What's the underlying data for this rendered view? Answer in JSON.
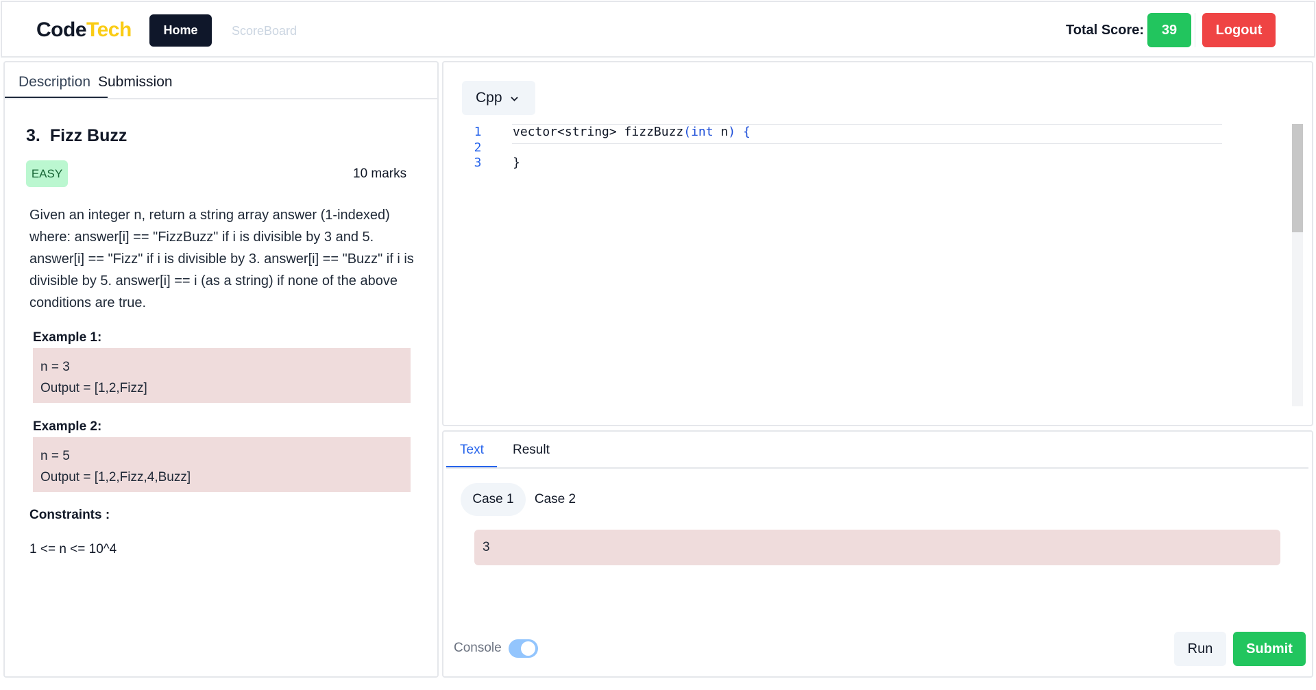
{
  "nav": {
    "logo_part1": "Code",
    "logo_part2": "Tech",
    "home_label": "Home",
    "scoreboard_label": "ScoreBoard",
    "total_score_label": "Total Score:",
    "total_score_value": "39",
    "logout_label": "Logout"
  },
  "problem_panel": {
    "tabs": [
      "Description",
      "Submission"
    ],
    "active_tab": "Description",
    "number": "3.",
    "title": "Fizz Buzz",
    "difficulty": "EASY",
    "marks": "10 marks",
    "description": "Given an integer n, return a string array answer (1-indexed) where: answer[i] == \"FizzBuzz\" if i is divisible by 3 and 5. answer[i] == \"Fizz\" if i is divisible by 3. answer[i] == \"Buzz\" if i is divisible by 5. answer[i] == i (as a string) if none of the above conditions are true.",
    "examples": [
      {
        "title": "Example 1:",
        "input": "n = 3",
        "output": "Output = [1,2,Fizz]"
      },
      {
        "title": "Example 2:",
        "input": "n = 5",
        "output": "Output = [1,2,Fizz,4,Buzz]"
      }
    ],
    "constraints_title": "Constraints :",
    "constraints": "1 <= n <= 10^4"
  },
  "editor": {
    "language": "Cpp",
    "lines": [
      {
        "num": "1",
        "prefix": "vector<string> fizzBuzz",
        "paren_open": "(",
        "kw": "int",
        "arg": " n",
        "paren_close": ")",
        "brace": " {"
      },
      {
        "num": "2"
      },
      {
        "num": "3",
        "brace": "}"
      }
    ]
  },
  "testcases": {
    "tabs": [
      "Text",
      "Result"
    ],
    "active_tab": "Text",
    "cases": [
      "Case 1",
      "Case 2"
    ],
    "active_case": "Case 1",
    "input_value": "3",
    "console_label": "Console",
    "console_enabled": true,
    "run_label": "Run",
    "submit_label": "Submit"
  },
  "colors": {
    "accent_green": "#22c55e",
    "logout_red": "#ef4444",
    "logo_yellow": "#facc15",
    "example_bg": "#efdcdc"
  }
}
